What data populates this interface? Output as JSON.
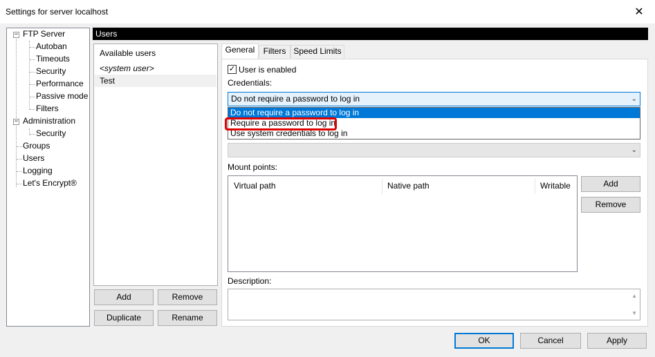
{
  "window": {
    "title": "Settings for server localhost",
    "close_glyph": "✕"
  },
  "tree": {
    "items": [
      {
        "label": "FTP Server",
        "expander": "−"
      },
      {
        "label": "Autoban"
      },
      {
        "label": "Timeouts"
      },
      {
        "label": "Security"
      },
      {
        "label": "Performance"
      },
      {
        "label": "Passive mode"
      },
      {
        "label": "Filters"
      },
      {
        "label": "Administration",
        "expander": "−"
      },
      {
        "label": "Security"
      },
      {
        "label": "Groups"
      },
      {
        "label": "Users"
      },
      {
        "label": "Logging"
      },
      {
        "label": "Let's Encrypt®"
      }
    ]
  },
  "section_header": "Users",
  "users": {
    "header": "Available users",
    "rows": [
      "<system user>",
      "Test"
    ],
    "add_label": "Add",
    "remove_label": "Remove",
    "duplicate_label": "Duplicate",
    "rename_label": "Rename"
  },
  "tabs": [
    "General",
    "Filters",
    "Speed Limits"
  ],
  "general": {
    "user_enabled_label": "User is enabled",
    "user_enabled_checked": "✓",
    "credentials_label": "Credentials:",
    "credentials_value": "Do not require a password to log in",
    "credentials_options": [
      "Do not require a password to log in",
      "Require a password to log in",
      "Use system credentials to log in"
    ],
    "mount_points_label": "Mount points:",
    "mount_columns": [
      "Virtual path",
      "Native path",
      "Writable"
    ],
    "mount_add_label": "Add",
    "mount_remove_label": "Remove",
    "description_label": "Description:"
  },
  "footer": {
    "ok_label": "OK",
    "cancel_label": "Cancel",
    "apply_label": "Apply"
  },
  "icons": {
    "chevron": "⌄",
    "scroll_up": "▲",
    "scroll_down": "▼"
  },
  "colors": {
    "accent": "#0078d7",
    "highlight_box": "#e00000",
    "section_header_bg": "#000000"
  }
}
